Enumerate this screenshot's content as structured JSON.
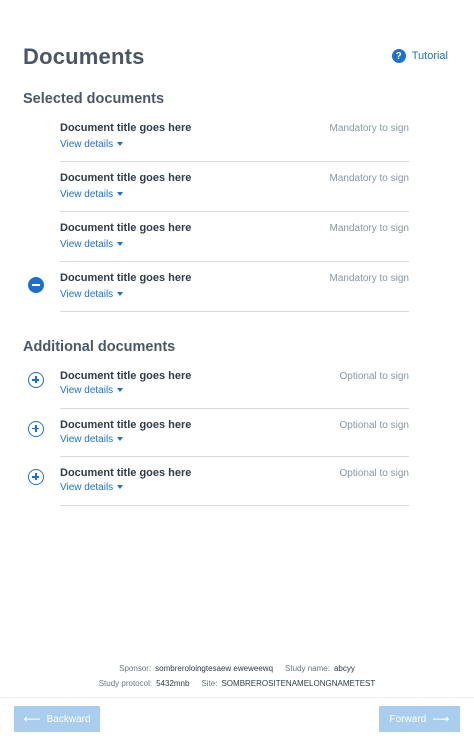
{
  "header": {
    "title": "Documents",
    "tutorial_label": "Tutorial",
    "tutorial_icon": "?"
  },
  "selected": {
    "title": "Selected documents",
    "items": [
      {
        "title": "Document title goes here",
        "view_details": "View details",
        "status": "Mandatory to sign"
      },
      {
        "title": "Document title goes here",
        "view_details": "View details",
        "status": "Mandatory to sign"
      },
      {
        "title": "Document title goes here",
        "view_details": "View details",
        "status": "Mandatory to sign"
      },
      {
        "title": "Document title goes here",
        "view_details": "View details",
        "status": "Mandatory to sign"
      }
    ]
  },
  "additional": {
    "title": "Additional documents",
    "items": [
      {
        "title": "Document title goes here",
        "view_details": "View details",
        "status": "Optional to sign"
      },
      {
        "title": "Document title goes here",
        "view_details": "View details",
        "status": "Optional to sign"
      },
      {
        "title": "Document title goes here",
        "view_details": "View details",
        "status": "Optional to sign"
      }
    ]
  },
  "footer": {
    "sponsor_label": "Sponsor:",
    "sponsor_value": "sombreroloingtesaew eweweewq",
    "study_name_label": "Study name:",
    "study_name_value": "abcyy",
    "protocol_label": "Study protocol:",
    "protocol_value": "5432mnb",
    "site_label": "Site:",
    "site_value": "SOMBREROSITENAMELONGNAMETEST"
  },
  "nav": {
    "backward_label": "Backward",
    "forward_label": "Forward",
    "backward_arrow": "⟵",
    "forward_arrow": "⟶"
  },
  "colors": {
    "accent": "#1f6fd1",
    "nav_button_disabled": "#a9cdef",
    "heading": "#4a5866",
    "muted": "#8a96a3"
  }
}
